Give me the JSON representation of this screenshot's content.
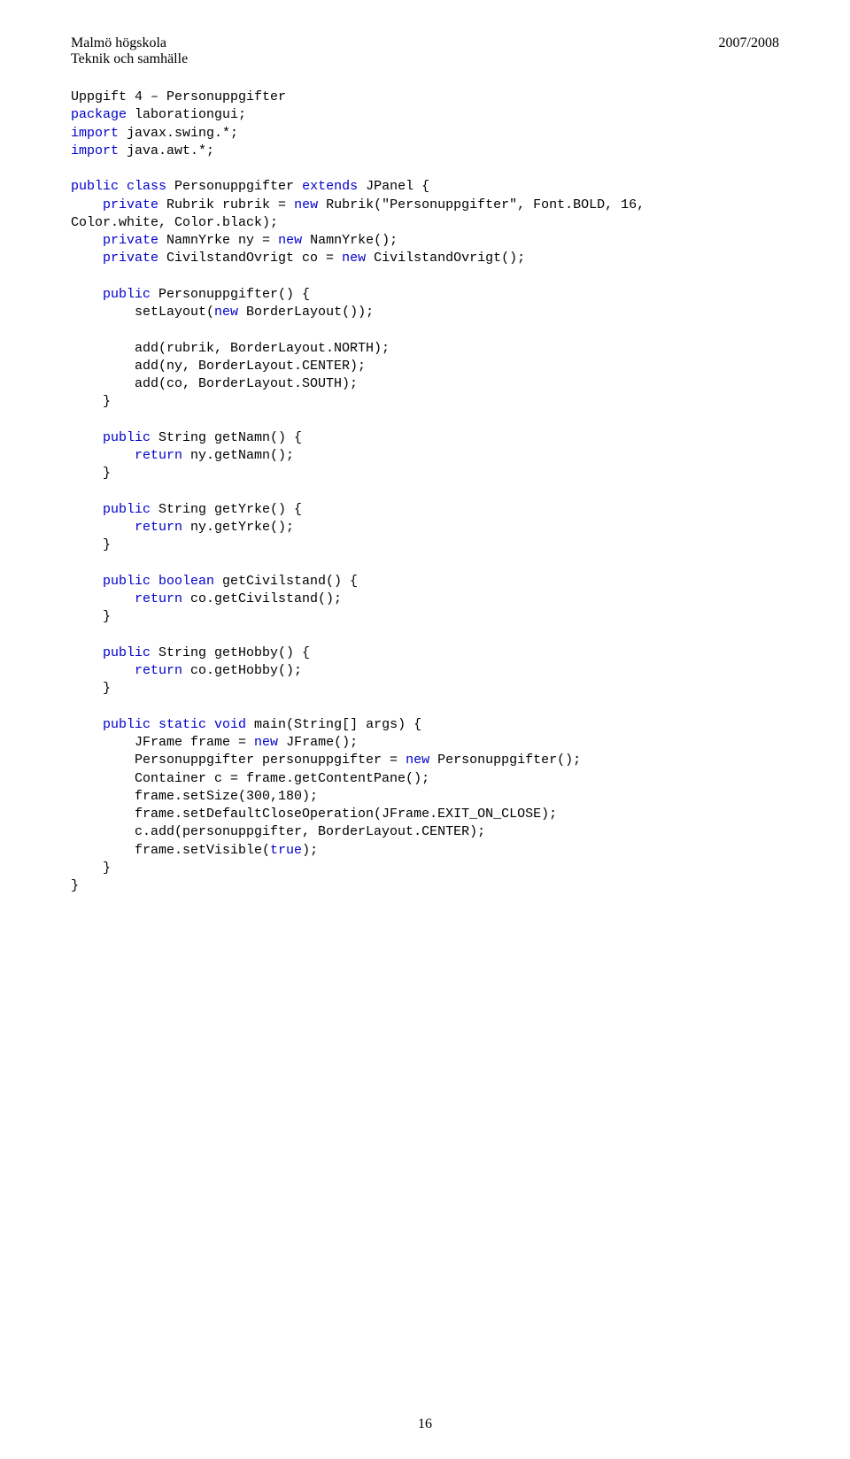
{
  "header": {
    "school": "Malmö högskola",
    "department": "Teknik och samhälle",
    "year": "2007/2008"
  },
  "code": {
    "title": "Uppgift 4 – Personuppgifter",
    "line1a": "package",
    "line1b": " laborationgui;",
    "line2a": "import",
    "line2b": " javax.swing.*;",
    "line3a": "import",
    "line3b": " java.awt.*;",
    "line5a": "public class",
    "line5b": " Personuppgifter ",
    "line5c": "extends",
    "line5d": " JPanel {",
    "line6a": "    private",
    "line6b": " Rubrik rubrik = ",
    "line6c": "new",
    "line6d": " Rubrik(\"Personuppgifter\", Font.BOLD, 16,",
    "line7": "Color.white, Color.black);",
    "line8a": "    private",
    "line8b": " NamnYrke ny = ",
    "line8c": "new",
    "line8d": " NamnYrke();",
    "line9a": "    private",
    "line9b": " CivilstandOvrigt co = ",
    "line9c": "new",
    "line9d": " CivilstandOvrigt();",
    "line11a": "    public",
    "line11b": " Personuppgifter() {",
    "line12a": "        setLayout(",
    "line12b": "new",
    "line12c": " BorderLayout());",
    "line14": "        add(rubrik, BorderLayout.NORTH);",
    "line15": "        add(ny, BorderLayout.CENTER);",
    "line16": "        add(co, BorderLayout.SOUTH);",
    "line17": "    }",
    "line19a": "    public",
    "line19b": " String getNamn() {",
    "line20a": "        return",
    "line20b": " ny.getNamn();",
    "line21": "    }",
    "line23a": "    public",
    "line23b": " String getYrke() {",
    "line24a": "        return",
    "line24b": " ny.getYrke();",
    "line25": "    }",
    "line27a": "    public boolean",
    "line27b": " getCivilstand() {",
    "line28a": "        return",
    "line28b": " co.getCivilstand();",
    "line29": "    }",
    "line31a": "    public",
    "line31b": " String getHobby() {",
    "line32a": "        return",
    "line32b": " co.getHobby();",
    "line33": "    }",
    "line35a": "    public static void",
    "line35b": " main(String[] args) {",
    "line36a": "        JFrame frame = ",
    "line36b": "new",
    "line36c": " JFrame();",
    "line37a": "        Personuppgifter personuppgifter = ",
    "line37b": "new",
    "line37c": " Personuppgifter();",
    "line38": "        Container c = frame.getContentPane();",
    "line39": "        frame.setSize(300,180);",
    "line40": "        frame.setDefaultCloseOperation(JFrame.EXIT_ON_CLOSE);",
    "line41": "        c.add(personuppgifter, BorderLayout.CENTER);",
    "line42a": "        frame.setVisible(",
    "line42b": "true",
    "line42c": ");",
    "line43": "    }",
    "line44": "}"
  },
  "footer": {
    "page_number": "16"
  }
}
